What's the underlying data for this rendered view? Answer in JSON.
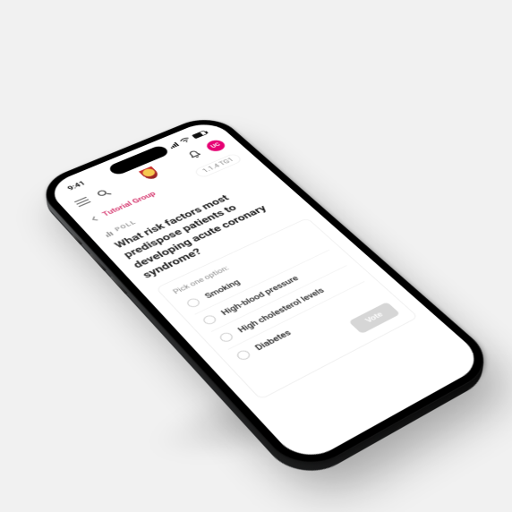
{
  "status": {
    "time": "9:41"
  },
  "avatar": {
    "initials": "UC"
  },
  "crumbs": {
    "group": "Tutorial Group",
    "path": "1.1.4  TG1"
  },
  "poll": {
    "label": "POLL",
    "question": "What risk factors most predispose patients to developing acute coronary syndrome?",
    "instruction": "Pick one option:",
    "options": [
      "Smoking",
      "High-blood pressure",
      "High cholesterol levels",
      "Diabetes"
    ],
    "vote_label": "Vote"
  }
}
